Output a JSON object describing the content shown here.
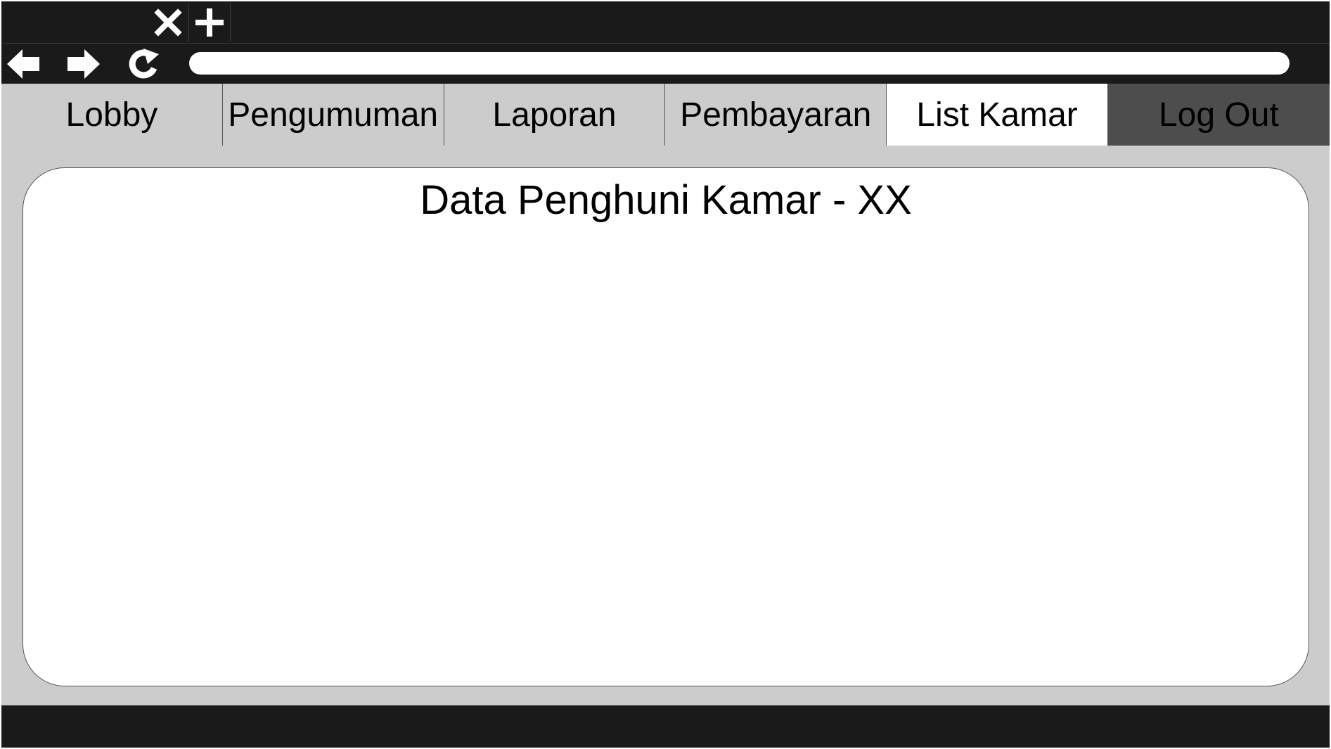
{
  "browser": {
    "tab_icons": {
      "close": "close-icon",
      "new_tab": "plus-icon"
    },
    "toolbar_icons": {
      "back": "arrow-left-icon",
      "forward": "arrow-right-icon",
      "reload": "reload-icon"
    },
    "address": {
      "value": "",
      "placeholder": ""
    }
  },
  "navbar": {
    "items": [
      {
        "label": "Lobby"
      },
      {
        "label": "Pengumuman"
      },
      {
        "label": "Laporan"
      },
      {
        "label": "Pembayaran"
      },
      {
        "label": "List Kamar"
      },
      {
        "label": "Log Out"
      }
    ],
    "active": "List Kamar"
  },
  "main": {
    "title": "Data Penghuni Kamar - XX"
  },
  "colors": {
    "chrome": "#1a1a1a",
    "page_bg": "#cccccc",
    "active_tab": "#ffffff",
    "logout_bg": "#4d4d4d",
    "card_bg": "#ffffff"
  }
}
